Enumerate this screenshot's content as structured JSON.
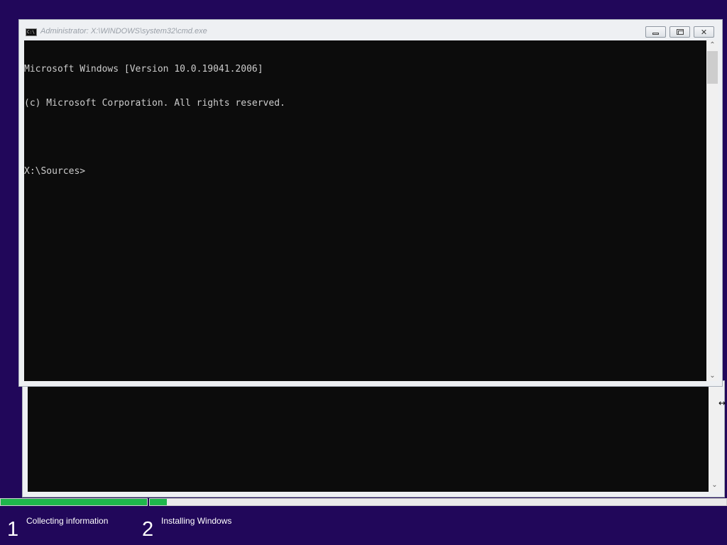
{
  "cmd_window": {
    "title": "Administrator: X:\\WINDOWS\\system32\\cmd.exe",
    "icon": "cmd-icon",
    "icon_text": "C:\\",
    "buttons": {
      "minimize": "minimize",
      "maximize": "restore",
      "close": "close"
    },
    "console_lines": [
      "Microsoft Windows [Version 10.0.19041.2006]",
      "(c) Microsoft Corporation. All rights reserved.",
      "",
      "X:\\Sources>"
    ],
    "colors": {
      "console_bg": "#0c0c0c",
      "console_fg": "#cccccc"
    }
  },
  "setup": {
    "steps": [
      {
        "number": "1",
        "label": "Collecting information",
        "progress": 1.0
      },
      {
        "number": "2",
        "label": "Installing Windows",
        "progress": 0.03
      }
    ],
    "colors": {
      "background": "#21075a",
      "progress_fill": "#1fb74c",
      "progress_track": "#eaeaea"
    }
  }
}
